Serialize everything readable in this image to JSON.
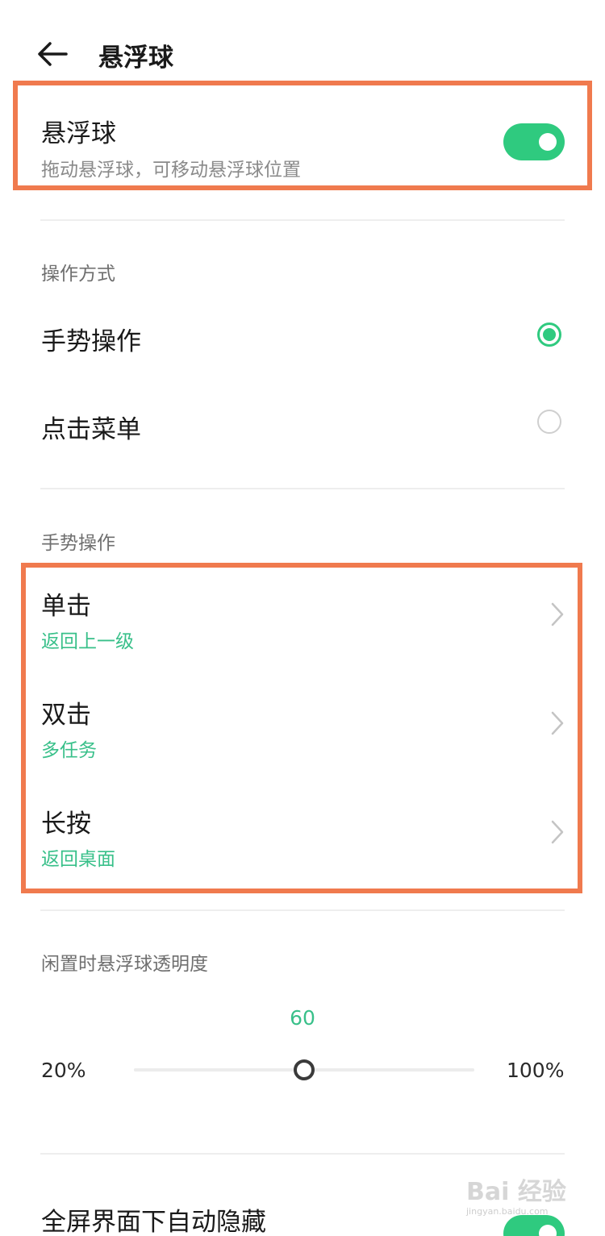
{
  "header": {
    "title": "悬浮球",
    "back_icon": "arrow-left-icon"
  },
  "floating_ball": {
    "title": "悬浮球",
    "subtitle": "拖动悬浮球，可移动悬浮球位置",
    "enabled": true
  },
  "operation_mode": {
    "header": "操作方式",
    "options": [
      {
        "label": "手势操作",
        "selected": true
      },
      {
        "label": "点击菜单",
        "selected": false
      }
    ]
  },
  "gestures": {
    "header": "手势操作",
    "items": [
      {
        "label": "单击",
        "value": "返回上一级"
      },
      {
        "label": "双击",
        "value": "多任务"
      },
      {
        "label": "长按",
        "value": "返回桌面"
      }
    ]
  },
  "opacity": {
    "header": "闲置时悬浮球透明度",
    "value": "60",
    "min_label": "20%",
    "max_label": "100%",
    "min": 20,
    "max": 100,
    "current": 60
  },
  "auto_hide": {
    "label": "全屏界面下自动隐藏",
    "enabled": true
  },
  "watermark": {
    "main": "Bai 经验",
    "sub": "jingyan.baidu.com"
  },
  "colors": {
    "accent": "#2fca7f",
    "highlight": "#f07a4e"
  }
}
